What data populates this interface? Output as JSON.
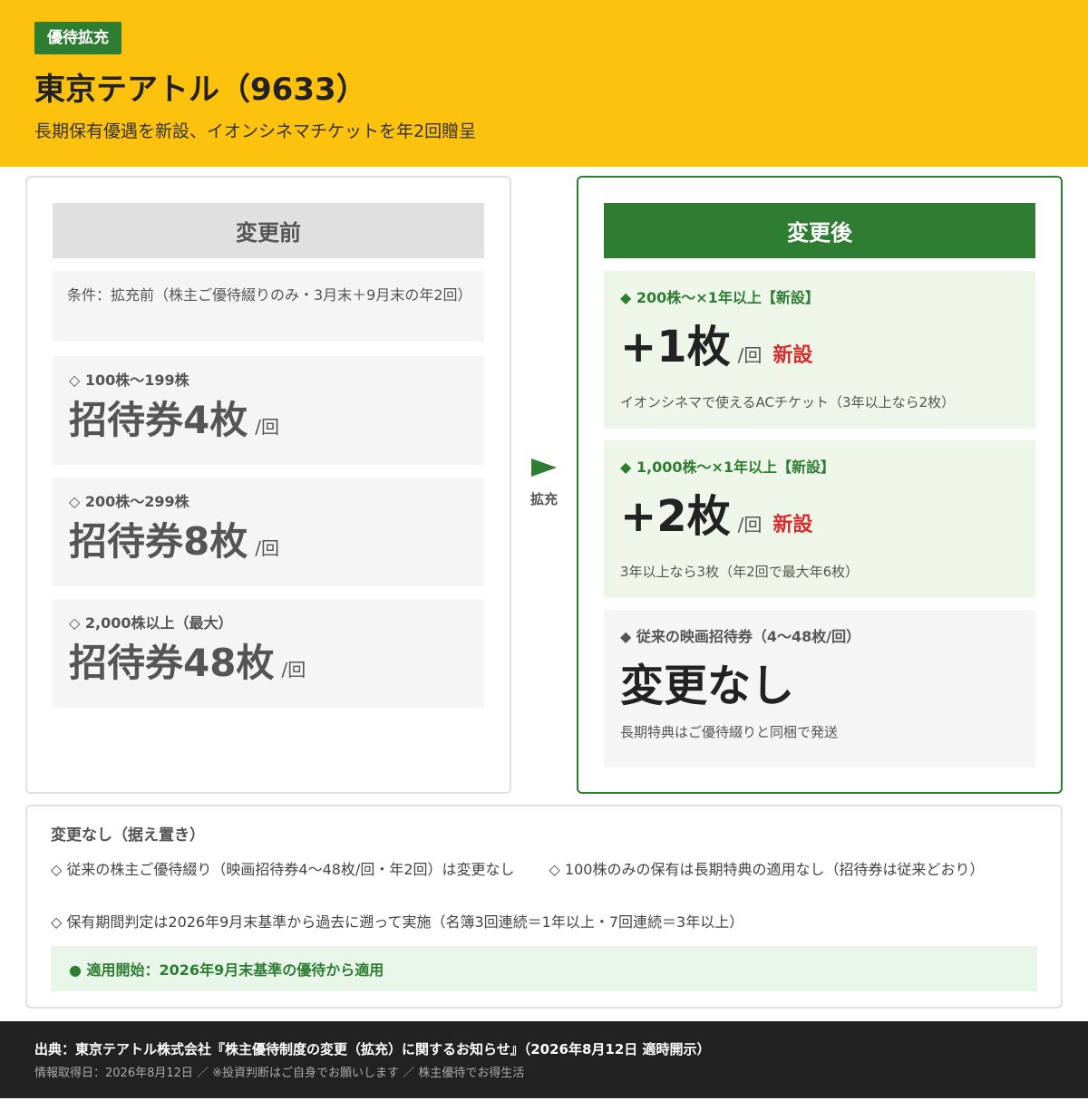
{
  "header": {
    "tag": "優待拡充",
    "title": "東京テアトル（9633）",
    "subtitle": "長期保有優遇を新設、イオンシネマチケットを年2回贈呈"
  },
  "before": {
    "heading": "変更前",
    "condition": "条件：拡充前（株主ご優待綴りのみ・3月末＋9月末の年2回）",
    "items": [
      {
        "label": "◇ 100株〜199株",
        "value": "招待券4枚",
        "per": "/回"
      },
      {
        "label": "◇ 200株〜299株",
        "value": "招待券8枚",
        "per": "/回"
      },
      {
        "label": "◇ 2,000株以上（最大）",
        "value": "招待券48枚",
        "per": "/回"
      }
    ]
  },
  "arrow": {
    "label": "拡充"
  },
  "after": {
    "heading": "変更後",
    "items": [
      {
        "label": "◆ 200株〜×1年以上【新設】",
        "value": "+1枚",
        "per": "/回",
        "badge": "新設",
        "note": "イオンシネマで使えるACチケット（3年以上なら2枚）"
      },
      {
        "label": "◆ 1,000株〜×1年以上【新設】",
        "value": "+2枚",
        "per": "/回",
        "badge": "新設",
        "note": "3年以上なら3枚（年2回で最大年6枚）"
      },
      {
        "label": "◆ 従来の映画招待券（4〜48枚/回）",
        "value": "変更なし",
        "note": "長期特典はご優待綴りと同梱で発送"
      }
    ]
  },
  "unchanged": {
    "title": "変更なし（据え置き）",
    "items": [
      "◇ 従来の株主ご優待綴り（映画招待券4〜48枚/回・年2回）は変更なし",
      "◇ 100株のみの保有は長期特典の適用なし（招待券は従来どおり）",
      "◇ 保有期間判定は2026年9月末基準から過去に遡って実施（名簿3回連続＝1年以上・7回連続＝3年以上）"
    ],
    "start": "● 適用開始：2026年9月末基準の優待から適用"
  },
  "footer": {
    "source": "出典：東京テアトル株式会社『株主優待制度の変更（拡充）に関するお知らせ』（2026年8月12日 適時開示）",
    "info": "情報取得日：2026年8月12日 ／ ※投資判断はご自身でお願いします ／ 株主優待でお得生活"
  },
  "colors": {
    "header_bg": "#fdc20e",
    "accent_green": "#2e7d32",
    "new_red": "#d32f2f",
    "footer_bg": "#222222"
  }
}
